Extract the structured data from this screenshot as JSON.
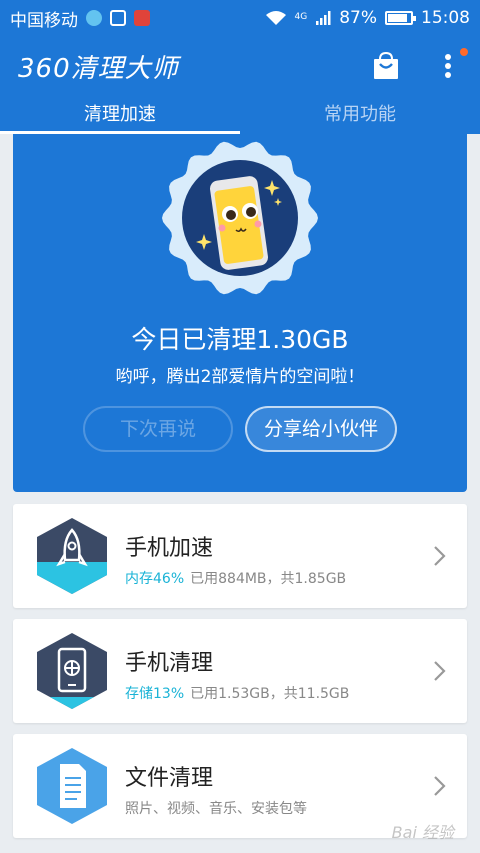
{
  "status_bar": {
    "carrier": "中国移动",
    "network": "4G",
    "battery": "87%",
    "battery_level": 0.87,
    "time": "15:08"
  },
  "app_bar": {
    "title": "360清理大师",
    "icons": [
      "shopping-bag-icon",
      "more-vertical-icon"
    ],
    "badge_color": "#ff6a2b"
  },
  "tabs": [
    {
      "label": "清理加速",
      "active": true
    },
    {
      "label": "常用功能",
      "active": false
    }
  ],
  "hero": {
    "title": "今日已清理1.30GB",
    "subtitle": "哟呼，腾出2部爱情片的空间啦！",
    "later_button": "下次再说",
    "share_button": "分享给小伙伴"
  },
  "cards": [
    {
      "title": "手机加速",
      "highlight": "内存46%",
      "detail": "已用884MB，共1.85GB",
      "icon": "rocket-icon"
    },
    {
      "title": "手机清理",
      "highlight": "存储13%",
      "detail": "已用1.53GB，共11.5GB",
      "icon": "phone-fan-icon"
    },
    {
      "title": "文件清理",
      "highlight": "",
      "detail": "照片、视频、音乐、安装包等",
      "icon": "document-icon"
    }
  ],
  "watermark": "Bai 经验",
  "colors": {
    "primary": "#1d77d6",
    "accent": "#1ab3d6",
    "dark_hex": "#3b4a66",
    "file_hex": "#4aa3e8"
  }
}
